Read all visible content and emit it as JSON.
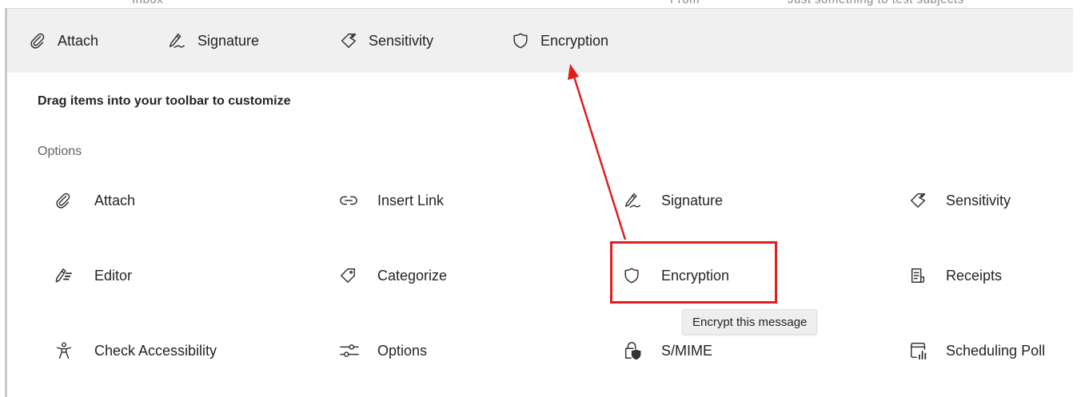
{
  "top_sliver": {
    "left_text": "Inbox",
    "mid_text": "From",
    "right_text": "Just something to test subjects"
  },
  "toolbar": {
    "items": [
      {
        "label": "Attach",
        "icon": "paperclip-icon"
      },
      {
        "label": "Signature",
        "icon": "signature-pen-icon"
      },
      {
        "label": "Sensitivity",
        "icon": "sensitivity-tag-icon"
      },
      {
        "label": "Encryption",
        "icon": "shield-icon"
      }
    ]
  },
  "panel": {
    "hint": "Drag items into your toolbar to customize",
    "section_title": "Options",
    "options": [
      {
        "label": "Attach",
        "icon": "paperclip-icon"
      },
      {
        "label": "Insert Link",
        "icon": "link-icon"
      },
      {
        "label": "Signature",
        "icon": "signature-pen-icon"
      },
      {
        "label": "Sensitivity",
        "icon": "sensitivity-tag-icon"
      },
      {
        "label": "Editor",
        "icon": "editor-pen-icon"
      },
      {
        "label": "Categorize",
        "icon": "tag-icon"
      },
      {
        "label": "Encryption",
        "icon": "shield-icon"
      },
      {
        "label": "Receipts",
        "icon": "receipt-icon"
      },
      {
        "label": "Check Accessibility",
        "icon": "accessibility-person-icon"
      },
      {
        "label": "Options",
        "icon": "sliders-icon"
      },
      {
        "label": "S/MIME",
        "icon": "lock-shield-icon"
      },
      {
        "label": "Scheduling Poll",
        "icon": "scheduling-poll-icon"
      }
    ],
    "tooltip": "Encrypt this message"
  },
  "annotation": {
    "color": "#e01e1e"
  }
}
